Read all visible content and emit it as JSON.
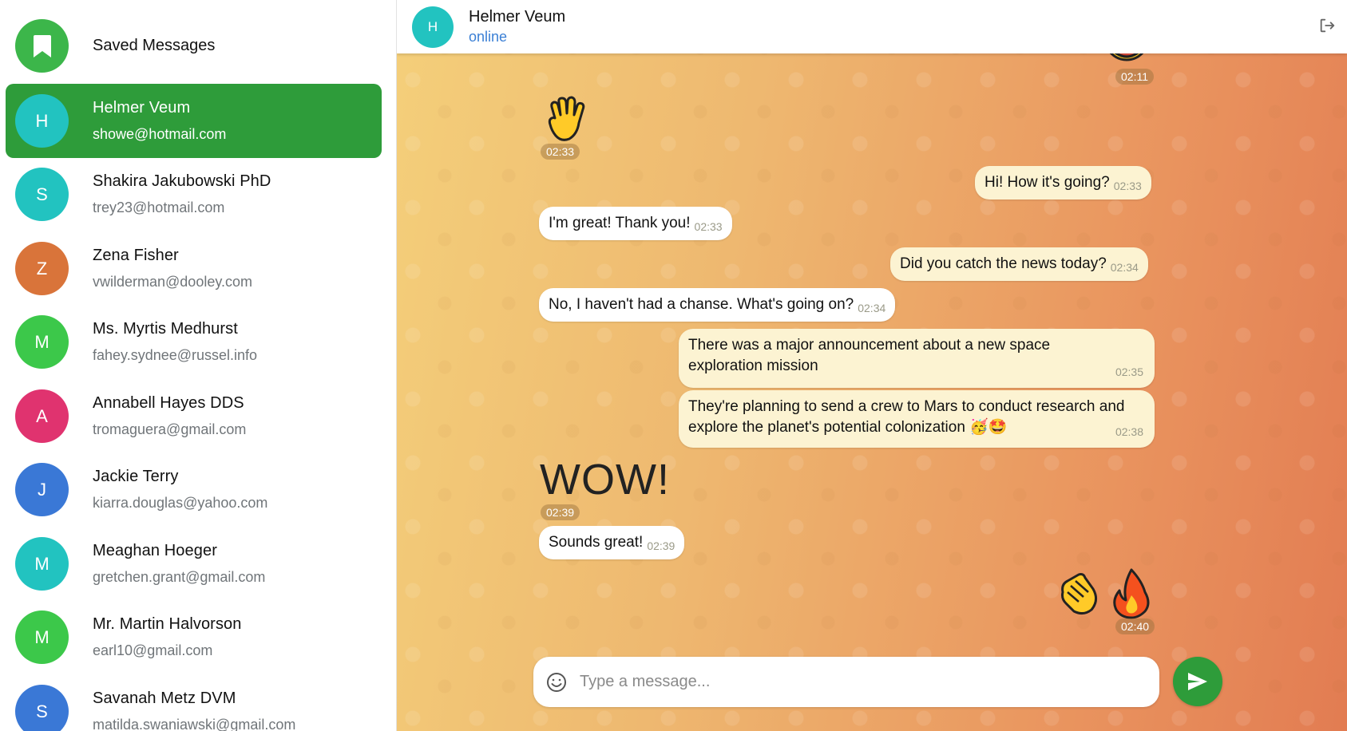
{
  "sidebar": {
    "saved": {
      "label": "Saved Messages",
      "color": "#3cb64a"
    },
    "chats": [
      {
        "initial": "H",
        "name": "Helmer Veum",
        "email": "showe@hotmail.com",
        "color": "#22c3c0",
        "active": true
      },
      {
        "initial": "S",
        "name": "Shakira Jakubowski PhD",
        "email": "trey23@hotmail.com",
        "color": "#22c3c0"
      },
      {
        "initial": "Z",
        "name": "Zena Fisher",
        "email": "vwilderman@dooley.com",
        "color": "#d9743a"
      },
      {
        "initial": "M",
        "name": "Ms. Myrtis Medhurst",
        "email": "fahey.sydnee@russel.info",
        "color": "#3cc84a"
      },
      {
        "initial": "A",
        "name": "Annabell Hayes DDS",
        "email": "tromaguera@gmail.com",
        "color": "#e0336f"
      },
      {
        "initial": "J",
        "name": "Jackie Terry",
        "email": "kiarra.douglas@yahoo.com",
        "color": "#3a78d6"
      },
      {
        "initial": "M",
        "name": "Meaghan Hoeger",
        "email": "gretchen.grant@gmail.com",
        "color": "#22c3c0"
      },
      {
        "initial": "M",
        "name": "Mr. Martin Halvorson",
        "email": "earl10@gmail.com",
        "color": "#3cc84a"
      },
      {
        "initial": "S",
        "name": "Savanah Metz DVM",
        "email": "matilda.swaniawski@gmail.com",
        "color": "#3a78d6"
      }
    ]
  },
  "header": {
    "initial": "H",
    "name": "Helmer Veum",
    "status": "online",
    "avatar_color": "#22c3c0"
  },
  "messages": {
    "top_sticker_time": "02:11",
    "wave_time": "02:33",
    "m1": {
      "text": "Hi! How it's going?",
      "time": "02:33"
    },
    "m2": {
      "text": "I'm great! Thank you!",
      "time": "02:33"
    },
    "m3": {
      "text": "Did you catch the news today?",
      "time": "02:34"
    },
    "m4": {
      "text": "No, I haven't had a chanse. What's going on?",
      "time": "02:34"
    },
    "m5": {
      "line1": "There was a major announcement about a new space",
      "line2": "exploration mission",
      "time": "02:35"
    },
    "m6": {
      "line1": "They're planning to send a crew to Mars to conduct research and",
      "line2": "explore the planet's potential colonization",
      "emoji": "🥳🤩",
      "time": "02:38"
    },
    "wow": {
      "text": "WOW!",
      "time": "02:39"
    },
    "m7": {
      "text": "Sounds great!",
      "time": "02:39"
    },
    "stickers_time": "02:40"
  },
  "composer": {
    "placeholder": "Type a message..."
  },
  "colors": {
    "accent": "#2e9c3a",
    "outgoing_bubble": "#fcf3d2",
    "incoming_bubble": "#ffffff",
    "status_blue": "#3a7fd5"
  }
}
